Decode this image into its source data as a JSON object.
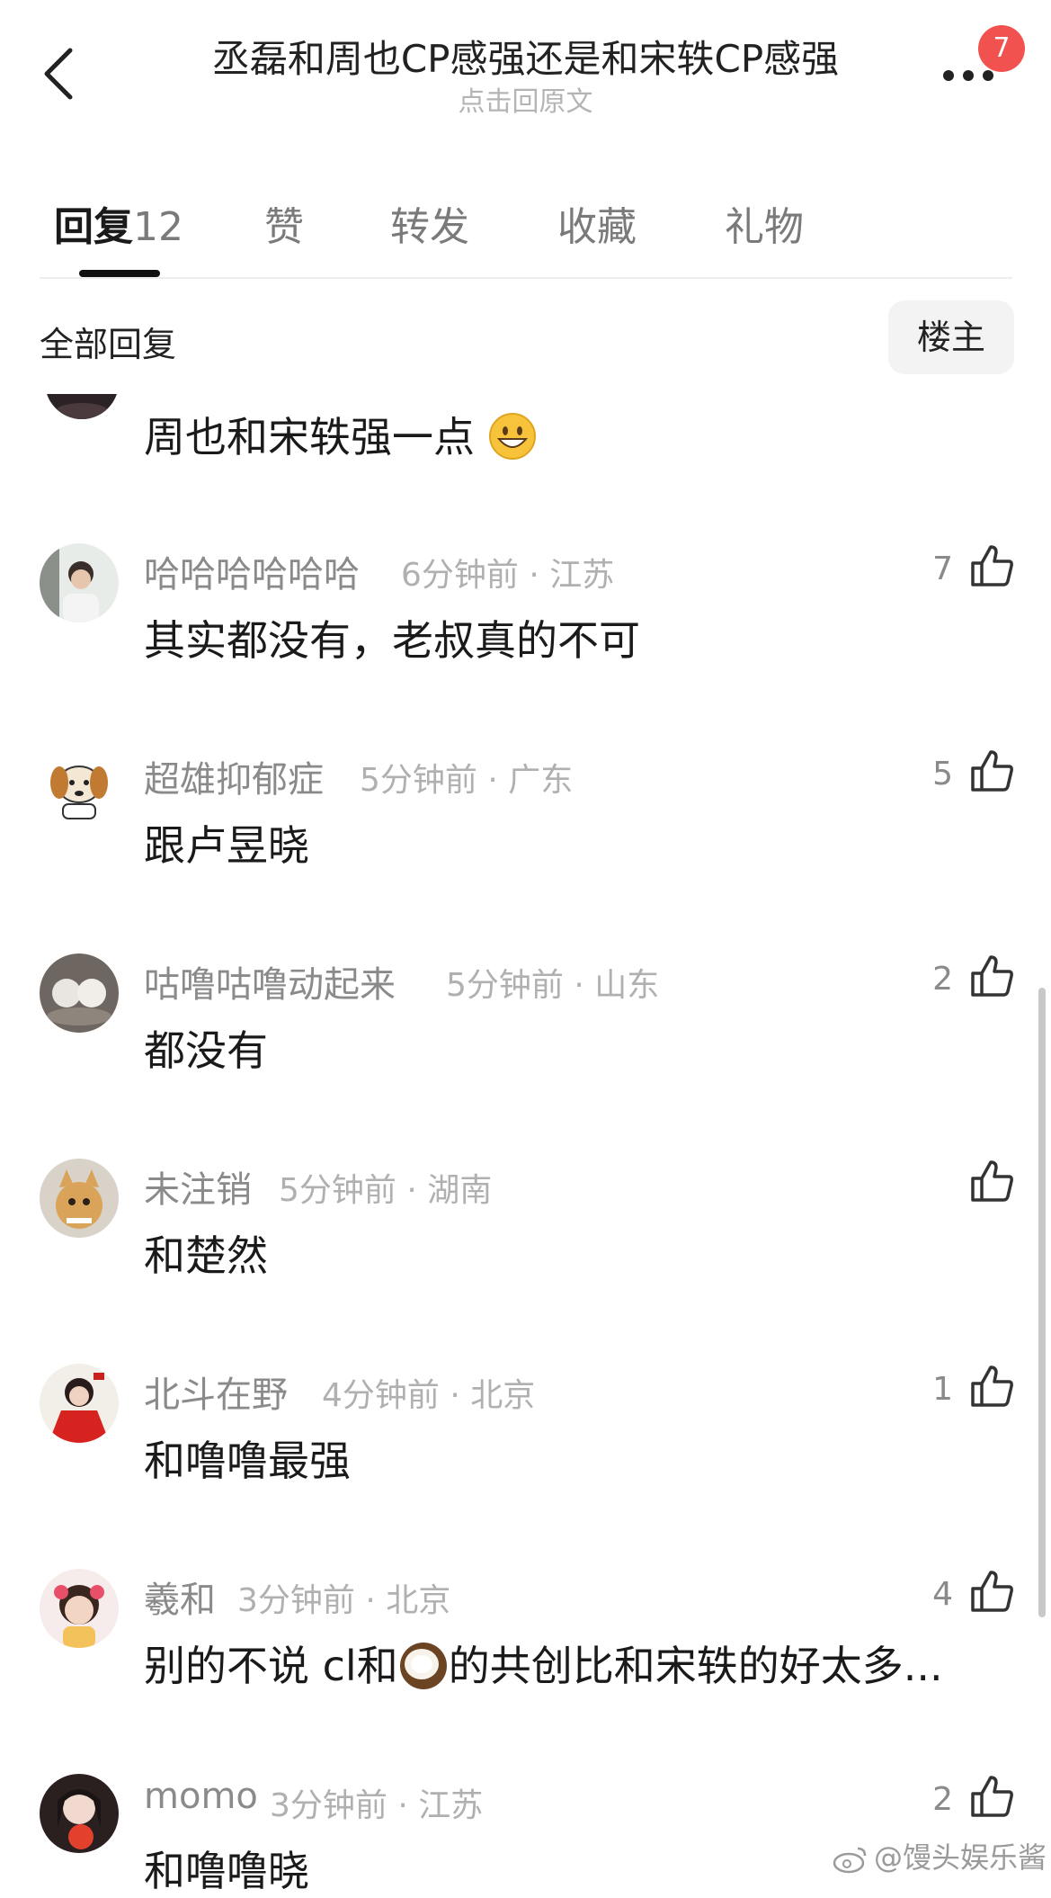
{
  "header": {
    "title": "丞磊和周也CP感强还是和宋轶CP感强",
    "subtitle": "点击回原文",
    "badge": "7"
  },
  "tabs": [
    {
      "label": "回复",
      "count": "12"
    },
    {
      "label": "赞"
    },
    {
      "label": "转发"
    },
    {
      "label": "收藏"
    },
    {
      "label": "礼物"
    }
  ],
  "filter": {
    "title": "全部回复",
    "owner_button": "楼主"
  },
  "comments": [
    {
      "content": "周也和宋轶强一点",
      "emoji": "grinning-face-emoji"
    },
    {
      "user": "哈哈哈哈哈哈",
      "time": "6分钟前 · 江苏",
      "content": "其实都没有，老叔真的不可",
      "likes": "7"
    },
    {
      "user": "超雄抑郁症",
      "time": "5分钟前 · 广东",
      "content": "跟卢昱晓",
      "likes": "5"
    },
    {
      "user": "咕噜咕噜动起来",
      "time": "5分钟前 · 山东",
      "content": "都没有",
      "likes": "2"
    },
    {
      "user": "未注销",
      "time": "5分钟前 · 湖南",
      "content": "和楚然",
      "likes": ""
    },
    {
      "user": "北斗在野",
      "time": "4分钟前 · 北京",
      "content": "和噜噜最强",
      "likes": "1"
    },
    {
      "user": "羲和",
      "time": "3分钟前 · 北京",
      "content_pre": "别的不说 cl和",
      "content_post": "的共创比和宋轶的好太多...",
      "emoji": "coconut-emoji",
      "likes": "4"
    },
    {
      "user": "momo",
      "time": "3分钟前 · 江苏",
      "content": "和噜噜晓",
      "likes": "2"
    }
  ],
  "watermark": "@馒头娱乐酱",
  "colors": {
    "badge": "#f2524f",
    "muted": "#8a8a8a",
    "meta": "#b0b0b0"
  }
}
